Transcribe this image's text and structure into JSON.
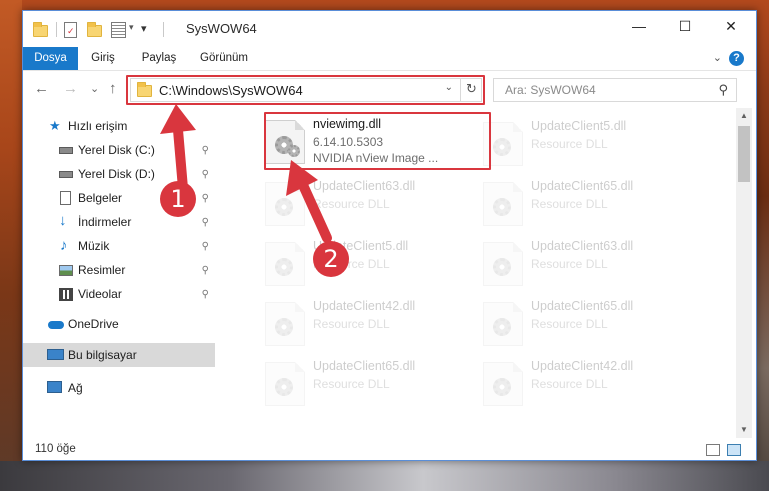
{
  "window": {
    "title": "SysWOW64",
    "controls": {
      "minimize": "—",
      "maximize": "☐",
      "close": "✕"
    }
  },
  "ribbon": {
    "tabs": [
      {
        "label": "Dosya",
        "active": true
      },
      {
        "label": "Giriş",
        "active": false
      },
      {
        "label": "Paylaş",
        "active": false
      },
      {
        "label": "Görünüm",
        "active": false
      }
    ],
    "collapse_glyph": "⌄",
    "help_glyph": "?"
  },
  "toolbar": {
    "back_glyph": "←",
    "forward_glyph": "→",
    "recent_glyph": "⌄",
    "up_glyph": "↑"
  },
  "address": {
    "path": "C:\\Windows\\SysWOW64",
    "dropdown_glyph": "⌄",
    "refresh_glyph": "↻"
  },
  "search": {
    "placeholder": "Ara: SysWOW64",
    "icon_glyph": "⚲"
  },
  "navigation": {
    "items": [
      {
        "label": "Hızlı erişim",
        "icon": "star-icon",
        "pinned": false,
        "indent": 1
      },
      {
        "label": "Yerel Disk (C:)",
        "icon": "drive-icon",
        "pinned": true,
        "indent": 2
      },
      {
        "label": "Yerel Disk (D:)",
        "icon": "drive-icon",
        "pinned": true,
        "indent": 2
      },
      {
        "label": "Belgeler",
        "icon": "document-icon",
        "pinned": true,
        "indent": 2
      },
      {
        "label": "İndirmeler",
        "icon": "download-icon",
        "pinned": true,
        "indent": 2
      },
      {
        "label": "Müzik",
        "icon": "music-icon",
        "pinned": true,
        "indent": 2
      },
      {
        "label": "Resimler",
        "icon": "pictures-icon",
        "pinned": true,
        "indent": 2
      },
      {
        "label": "Videolar",
        "icon": "video-icon",
        "pinned": true,
        "indent": 2
      },
      {
        "label": "OneDrive",
        "icon": "cloud-icon",
        "pinned": false,
        "indent": 1
      },
      {
        "label": "Bu bilgisayar",
        "icon": "computer-icon",
        "pinned": false,
        "indent": 1,
        "selected": true
      },
      {
        "label": "Ağ",
        "icon": "network-icon",
        "pinned": false,
        "indent": 1
      }
    ],
    "pin_glyph": "📌"
  },
  "files": {
    "highlighted": {
      "name": "nviewimg.dll",
      "version": "6.14.10.5303",
      "description": "NVIDIA nView Image ..."
    },
    "background": [
      {
        "name": "UpdateClient5.dll",
        "type": "Resource DLL"
      },
      {
        "name": "UpdateClient63.dll",
        "type": "Resource DLL"
      },
      {
        "name": "UpdateClient65.dll",
        "type": "Resource DLL"
      },
      {
        "name": "UpdateClient5.dll",
        "type": "Resource DLL"
      },
      {
        "name": "UpdateClient63.dll",
        "type": "Resource DLL"
      },
      {
        "name": "UpdateClient42.dll",
        "type": "Resource DLL"
      },
      {
        "name": "UpdateClient65.dll",
        "type": "Resource DLL"
      },
      {
        "name": "UpdateClient65.dll",
        "type": "Resource DLL"
      },
      {
        "name": "UpdateClient42.dll",
        "type": "Resource DLL"
      }
    ]
  },
  "status": {
    "item_count": "110 öğe"
  },
  "annotations": {
    "marker_1": "1",
    "marker_2": "2",
    "accent_color": "#d9363e"
  },
  "colors": {
    "ribbon_active": "#1979ca",
    "selection": "#d9d9d9"
  }
}
